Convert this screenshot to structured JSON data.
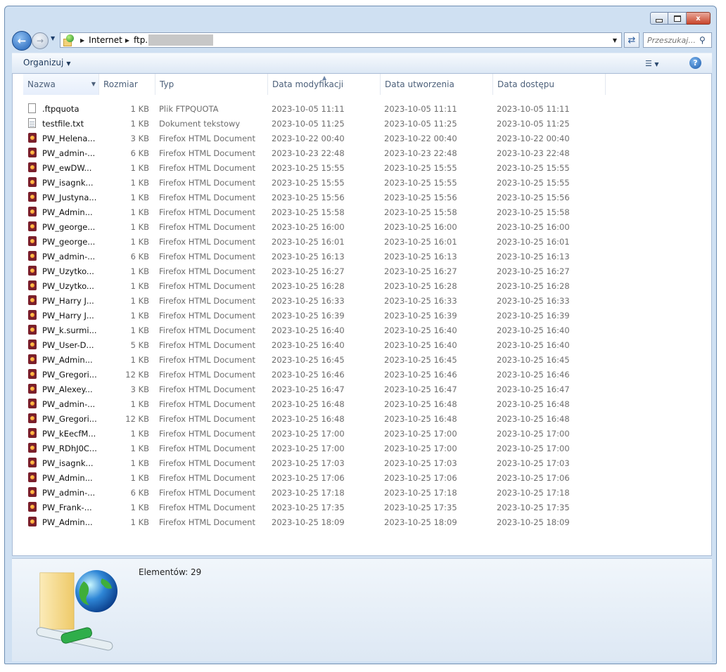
{
  "window": {
    "caption_buttons": {
      "minimize": "–",
      "maximize": "□",
      "close": "x"
    }
  },
  "address_bar": {
    "crumbs": [
      "Internet",
      "ftp."
    ],
    "search_placeholder": "Przeszukaj..."
  },
  "toolbar": {
    "organize_label": "Organizuj",
    "views_icon": "views-icon",
    "help_label": "?"
  },
  "columns": [
    {
      "label": "Nazwa"
    },
    {
      "label": "Rozmiar"
    },
    {
      "label": "Typ"
    },
    {
      "label": "Data modyfikacji"
    },
    {
      "label": "Data utworzenia"
    },
    {
      "label": "Data dostępu"
    }
  ],
  "files": [
    {
      "icon": "file",
      "name": ".ftpquota",
      "size": "1 KB",
      "type": "Plik FTPQUOTA",
      "modified": "2023-10-05 11:11",
      "created": "2023-10-05 11:11",
      "accessed": "2023-10-05 11:11"
    },
    {
      "icon": "text",
      "name": "testfile.txt",
      "size": "1 KB",
      "type": "Dokument tekstowy",
      "modified": "2023-10-05 11:25",
      "created": "2023-10-05 11:25",
      "accessed": "2023-10-05 11:25"
    },
    {
      "icon": "html",
      "name": "PW_Helena...",
      "size": "3 KB",
      "type": "Firefox HTML Document",
      "modified": "2023-10-22 00:40",
      "created": "2023-10-22 00:40",
      "accessed": "2023-10-22 00:40"
    },
    {
      "icon": "html",
      "name": "PW_admin-...",
      "size": "6 KB",
      "type": "Firefox HTML Document",
      "modified": "2023-10-23 22:48",
      "created": "2023-10-23 22:48",
      "accessed": "2023-10-23 22:48"
    },
    {
      "icon": "html",
      "name": "PW_ewDW...",
      "size": "1 KB",
      "type": "Firefox HTML Document",
      "modified": "2023-10-25 15:55",
      "created": "2023-10-25 15:55",
      "accessed": "2023-10-25 15:55"
    },
    {
      "icon": "html",
      "name": "PW_isagnk...",
      "size": "1 KB",
      "type": "Firefox HTML Document",
      "modified": "2023-10-25 15:55",
      "created": "2023-10-25 15:55",
      "accessed": "2023-10-25 15:55"
    },
    {
      "icon": "html",
      "name": "PW_Justyna...",
      "size": "1 KB",
      "type": "Firefox HTML Document",
      "modified": "2023-10-25 15:56",
      "created": "2023-10-25 15:56",
      "accessed": "2023-10-25 15:56"
    },
    {
      "icon": "html",
      "name": "PW_Admin...",
      "size": "1 KB",
      "type": "Firefox HTML Document",
      "modified": "2023-10-25 15:58",
      "created": "2023-10-25 15:58",
      "accessed": "2023-10-25 15:58"
    },
    {
      "icon": "html",
      "name": "PW_george...",
      "size": "1 KB",
      "type": "Firefox HTML Document",
      "modified": "2023-10-25 16:00",
      "created": "2023-10-25 16:00",
      "accessed": "2023-10-25 16:00"
    },
    {
      "icon": "html",
      "name": "PW_george...",
      "size": "1 KB",
      "type": "Firefox HTML Document",
      "modified": "2023-10-25 16:01",
      "created": "2023-10-25 16:01",
      "accessed": "2023-10-25 16:01"
    },
    {
      "icon": "html",
      "name": "PW_admin-...",
      "size": "6 KB",
      "type": "Firefox HTML Document",
      "modified": "2023-10-25 16:13",
      "created": "2023-10-25 16:13",
      "accessed": "2023-10-25 16:13"
    },
    {
      "icon": "html",
      "name": "PW_Uzytko...",
      "size": "1 KB",
      "type": "Firefox HTML Document",
      "modified": "2023-10-25 16:27",
      "created": "2023-10-25 16:27",
      "accessed": "2023-10-25 16:27"
    },
    {
      "icon": "html",
      "name": "PW_Uzytko...",
      "size": "1 KB",
      "type": "Firefox HTML Document",
      "modified": "2023-10-25 16:28",
      "created": "2023-10-25 16:28",
      "accessed": "2023-10-25 16:28"
    },
    {
      "icon": "html",
      "name": "PW_Harry J...",
      "size": "1 KB",
      "type": "Firefox HTML Document",
      "modified": "2023-10-25 16:33",
      "created": "2023-10-25 16:33",
      "accessed": "2023-10-25 16:33"
    },
    {
      "icon": "html",
      "name": "PW_Harry J...",
      "size": "1 KB",
      "type": "Firefox HTML Document",
      "modified": "2023-10-25 16:39",
      "created": "2023-10-25 16:39",
      "accessed": "2023-10-25 16:39"
    },
    {
      "icon": "html",
      "name": "PW_k.surmi...",
      "size": "1 KB",
      "type": "Firefox HTML Document",
      "modified": "2023-10-25 16:40",
      "created": "2023-10-25 16:40",
      "accessed": "2023-10-25 16:40"
    },
    {
      "icon": "html",
      "name": "PW_User-D...",
      "size": "5 KB",
      "type": "Firefox HTML Document",
      "modified": "2023-10-25 16:40",
      "created": "2023-10-25 16:40",
      "accessed": "2023-10-25 16:40"
    },
    {
      "icon": "html",
      "name": "PW_Admin...",
      "size": "1 KB",
      "type": "Firefox HTML Document",
      "modified": "2023-10-25 16:45",
      "created": "2023-10-25 16:45",
      "accessed": "2023-10-25 16:45"
    },
    {
      "icon": "html",
      "name": "PW_Gregori...",
      "size": "12 KB",
      "type": "Firefox HTML Document",
      "modified": "2023-10-25 16:46",
      "created": "2023-10-25 16:46",
      "accessed": "2023-10-25 16:46"
    },
    {
      "icon": "html",
      "name": "PW_Alexey...",
      "size": "3 KB",
      "type": "Firefox HTML Document",
      "modified": "2023-10-25 16:47",
      "created": "2023-10-25 16:47",
      "accessed": "2023-10-25 16:47"
    },
    {
      "icon": "html",
      "name": "PW_admin-...",
      "size": "1 KB",
      "type": "Firefox HTML Document",
      "modified": "2023-10-25 16:48",
      "created": "2023-10-25 16:48",
      "accessed": "2023-10-25 16:48"
    },
    {
      "icon": "html",
      "name": "PW_Gregori...",
      "size": "12 KB",
      "type": "Firefox HTML Document",
      "modified": "2023-10-25 16:48",
      "created": "2023-10-25 16:48",
      "accessed": "2023-10-25 16:48"
    },
    {
      "icon": "html",
      "name": "PW_kEecfM...",
      "size": "1 KB",
      "type": "Firefox HTML Document",
      "modified": "2023-10-25 17:00",
      "created": "2023-10-25 17:00",
      "accessed": "2023-10-25 17:00"
    },
    {
      "icon": "html",
      "name": "PW_RDhJ0C...",
      "size": "1 KB",
      "type": "Firefox HTML Document",
      "modified": "2023-10-25 17:00",
      "created": "2023-10-25 17:00",
      "accessed": "2023-10-25 17:00"
    },
    {
      "icon": "html",
      "name": "PW_isagnk...",
      "size": "1 KB",
      "type": "Firefox HTML Document",
      "modified": "2023-10-25 17:03",
      "created": "2023-10-25 17:03",
      "accessed": "2023-10-25 17:03"
    },
    {
      "icon": "html",
      "name": "PW_Admin...",
      "size": "1 KB",
      "type": "Firefox HTML Document",
      "modified": "2023-10-25 17:06",
      "created": "2023-10-25 17:06",
      "accessed": "2023-10-25 17:06"
    },
    {
      "icon": "html",
      "name": "PW_admin-...",
      "size": "6 KB",
      "type": "Firefox HTML Document",
      "modified": "2023-10-25 17:18",
      "created": "2023-10-25 17:18",
      "accessed": "2023-10-25 17:18"
    },
    {
      "icon": "html",
      "name": "PW_Frank-...",
      "size": "1 KB",
      "type": "Firefox HTML Document",
      "modified": "2023-10-25 17:35",
      "created": "2023-10-25 17:35",
      "accessed": "2023-10-25 17:35"
    },
    {
      "icon": "html",
      "name": "PW_Admin...",
      "size": "1 KB",
      "type": "Firefox HTML Document",
      "modified": "2023-10-25 18:09",
      "created": "2023-10-25 18:09",
      "accessed": "2023-10-25 18:09"
    }
  ],
  "details_pane": {
    "count_label": "Elementów: 29",
    "icon": "network-folder-icon"
  }
}
